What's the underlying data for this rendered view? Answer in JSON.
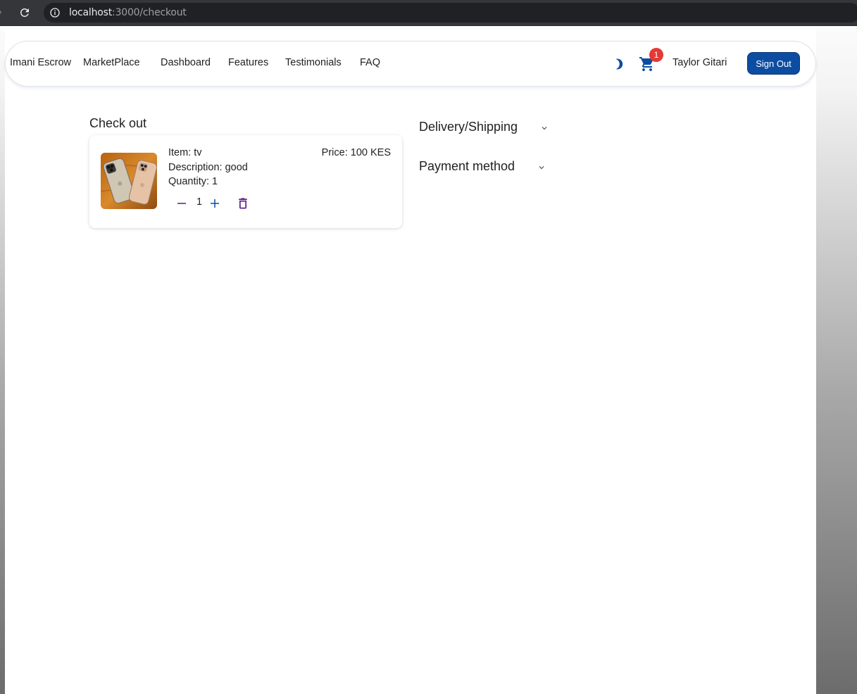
{
  "browser": {
    "url_host": "localhost",
    "url_path": ":3000/checkout"
  },
  "nav": {
    "brand": "Imani Escrow",
    "links": [
      "MarketPlace",
      "Dashboard",
      "Features",
      "Testimonials",
      "FAQ"
    ],
    "cart_count": "1",
    "user_name": "Taylor Gitari",
    "sign_out": "Sign Out"
  },
  "checkout": {
    "title": "Check out",
    "item": {
      "name_line": "Item: tv",
      "description_line": "Description: good",
      "quantity_line": "Quantity: 1",
      "price_line": "Price: 100 KES",
      "quantity_value": "1"
    }
  },
  "sections": {
    "delivery": "Delivery/Shipping",
    "payment": "Payment method"
  },
  "colors": {
    "primary": "#0d4da1",
    "badge": "#e53935",
    "control_purple": "#5b1a8a"
  }
}
